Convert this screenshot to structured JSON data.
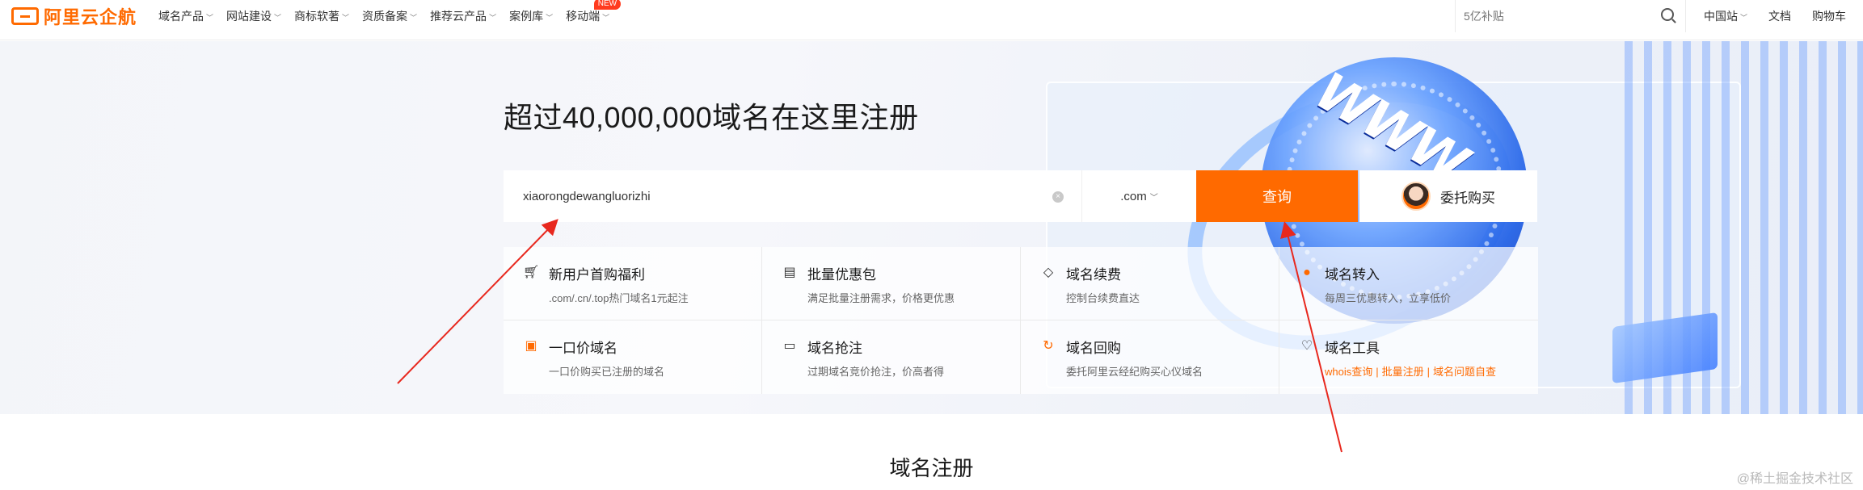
{
  "header": {
    "logo_text": "阿里云企航",
    "nav": [
      {
        "label": "域名产品"
      },
      {
        "label": "网站建设"
      },
      {
        "label": "商标软著"
      },
      {
        "label": "资质备案"
      },
      {
        "label": "推荐云产品"
      },
      {
        "label": "案例库"
      },
      {
        "label": "移动端",
        "badge": "NEW"
      }
    ],
    "search_placeholder": "5亿补贴",
    "right_links": {
      "region": "中国站",
      "docs": "文档",
      "cart": "购物车"
    }
  },
  "hero": {
    "title": "超过40,000,000域名在这里注册",
    "search": {
      "value": "xiaorongdewangluorizhi",
      "suffix": ".com",
      "query_label": "查询",
      "entrust_label": "委托购买"
    },
    "features": [
      {
        "icon": "cart-icon",
        "title": "新用户首购福利",
        "desc": ".com/.cn/.top热门域名1元起注"
      },
      {
        "icon": "package-icon",
        "title": "批量优惠包",
        "desc": "满足批量注册需求，价格更优惠"
      },
      {
        "icon": "tag-icon",
        "title": "域名续费",
        "desc": "控制台续费直达"
      },
      {
        "icon": "transfer-icon",
        "title": "域名转入",
        "desc": "每周三优惠转入，立享低价"
      },
      {
        "icon": "price-icon",
        "title": "一口价域名",
        "desc": "一口价购买已注册的域名"
      },
      {
        "icon": "snatch-icon",
        "title": "域名抢注",
        "desc": "过期域名竞价抢注，价高者得"
      },
      {
        "icon": "buyback-icon",
        "title": "域名回购",
        "desc": "委托阿里云经纪购买心仪域名"
      },
      {
        "icon": "tools-icon",
        "title": "域名工具",
        "links": [
          "whois查询",
          "批量注册",
          "域名问题自查"
        ]
      }
    ]
  },
  "section_title": "域名注册",
  "watermark": "@稀土掘金技术社区",
  "colors": {
    "accent": "#ff6a00",
    "annotation_arrow": "#e8281e"
  }
}
